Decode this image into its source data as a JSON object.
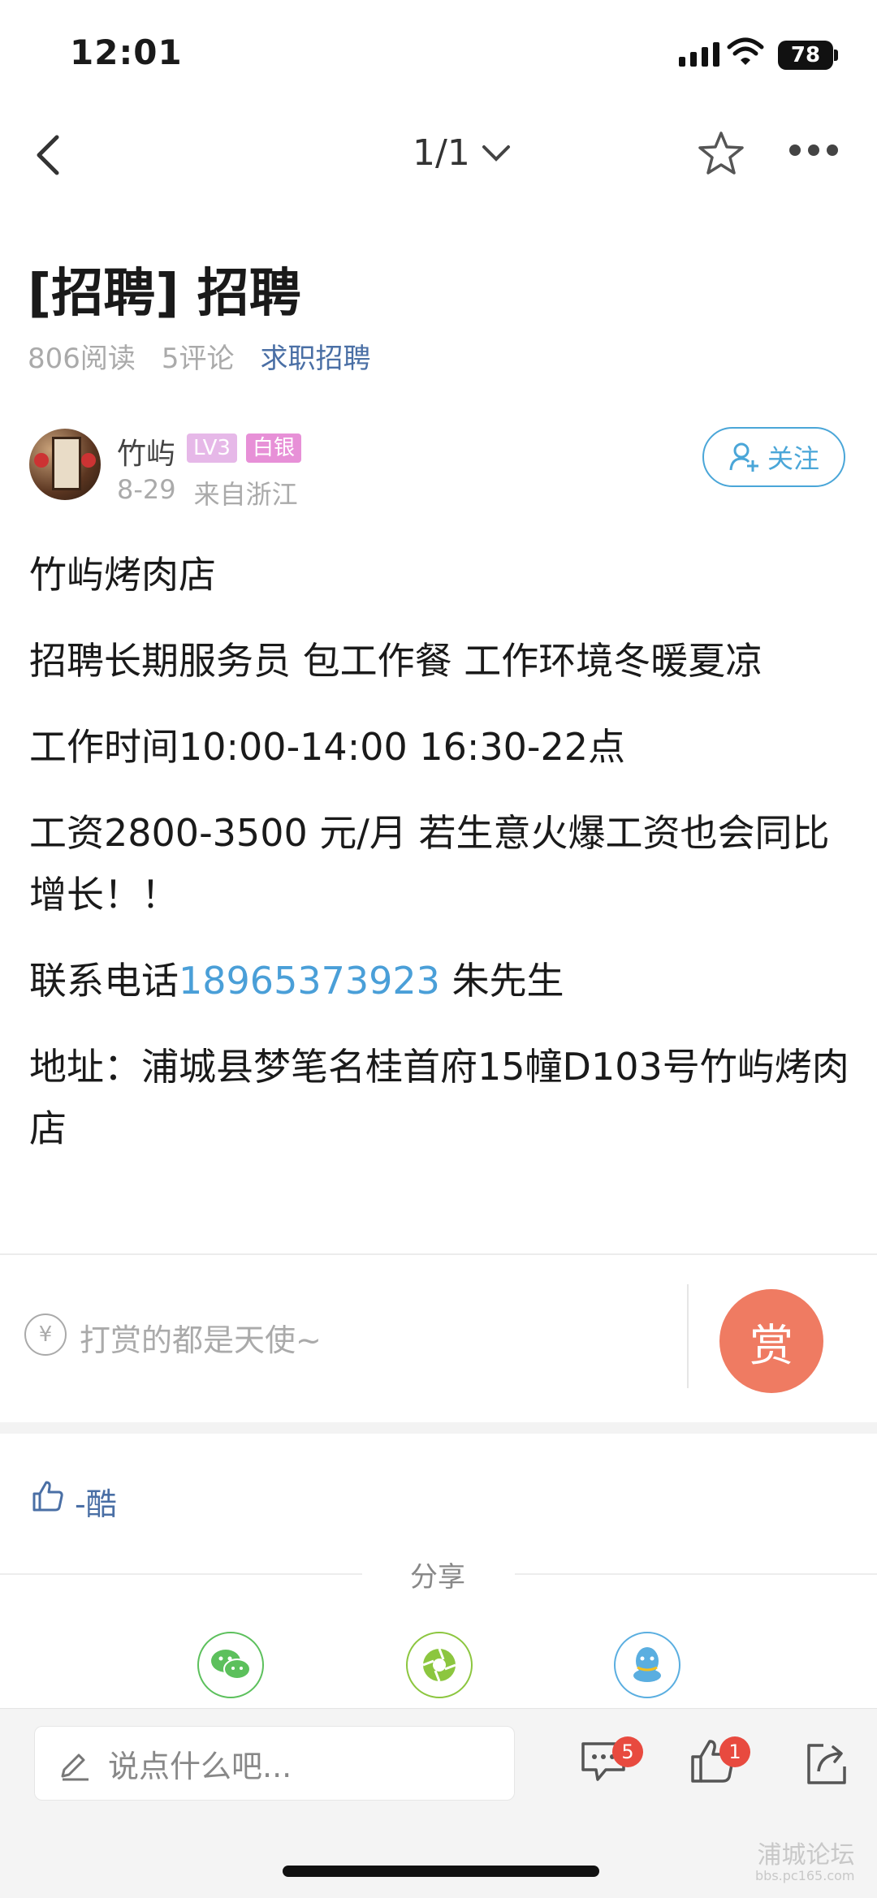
{
  "status_bar": {
    "time": "12:01",
    "battery": "78"
  },
  "nav": {
    "pager": "1/1"
  },
  "post": {
    "title": "[招聘] 招聘",
    "reads": "806阅读",
    "comments": "5评论",
    "category": "求职招聘"
  },
  "author": {
    "name": "竹屿",
    "level": "LV3",
    "rank": "白银",
    "date": "8-29",
    "location": "来自浙江",
    "follow_label": "关注"
  },
  "content": {
    "p1": "竹屿烤肉店",
    "p2": "招聘长期服务员 包工作餐 工作环境冬暖夏凉",
    "p3": "工作时间10:00-14:00 16:30-22点",
    "p4": "工资2800-3500 元/月 若生意火爆工资也会同比增长！！",
    "p5_prefix": "联系电话",
    "p5_phone": "18965373923",
    "p5_suffix": " 朱先生",
    "p6": "地址：浦城县梦笔名桂首府15幢D103号竹屿烤肉店"
  },
  "reward": {
    "placeholder": "打赏的都是天使~",
    "button": "赏",
    "yen": "¥"
  },
  "likes": {
    "users": "-酷"
  },
  "share": {
    "title": "分享"
  },
  "bottom_bar": {
    "input_placeholder": "说点什么吧...",
    "comments_count": "5",
    "likes_count": "1"
  },
  "watermark": {
    "text": "浦城论坛",
    "sub": "bbs.pc165.com"
  },
  "colors": {
    "accent": "#4aa6d8",
    "reward": "#ef7b62",
    "badge": "#e84a3f",
    "link": "#4a6fa5"
  }
}
